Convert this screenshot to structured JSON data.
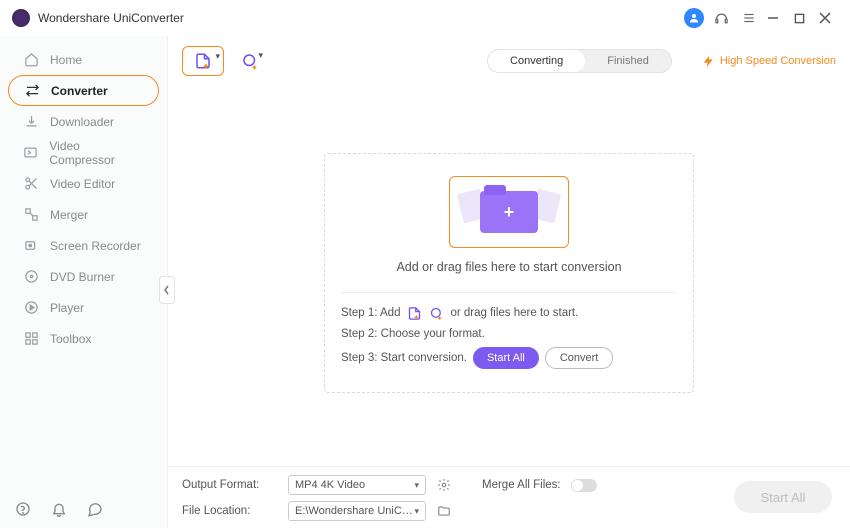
{
  "app": {
    "title": "Wondershare UniConverter"
  },
  "sidebar": {
    "items": [
      {
        "label": "Home"
      },
      {
        "label": "Converter"
      },
      {
        "label": "Downloader"
      },
      {
        "label": "Video Compressor"
      },
      {
        "label": "Video Editor"
      },
      {
        "label": "Merger"
      },
      {
        "label": "Screen Recorder"
      },
      {
        "label": "DVD Burner"
      },
      {
        "label": "Player"
      },
      {
        "label": "Toolbox"
      }
    ],
    "active_index": 1
  },
  "toolbar": {
    "tabs": {
      "converting": "Converting",
      "finished": "Finished",
      "active": "converting"
    },
    "high_speed": "High Speed Conversion"
  },
  "dropzone": {
    "headline": "Add or drag files here to start conversion",
    "step1_prefix": "Step 1: Add",
    "step1_suffix": "or drag files here to start.",
    "step2": "Step 2: Choose your format.",
    "step3_prefix": "Step 3: Start conversion.",
    "start_all": "Start All",
    "convert": "Convert"
  },
  "bottom": {
    "output_format_label": "Output Format:",
    "output_format_value": "MP4 4K Video",
    "file_location_label": "File Location:",
    "file_location_value": "E:\\Wondershare UniConverter",
    "merge_label": "Merge All Files:",
    "start_all_btn": "Start All"
  }
}
